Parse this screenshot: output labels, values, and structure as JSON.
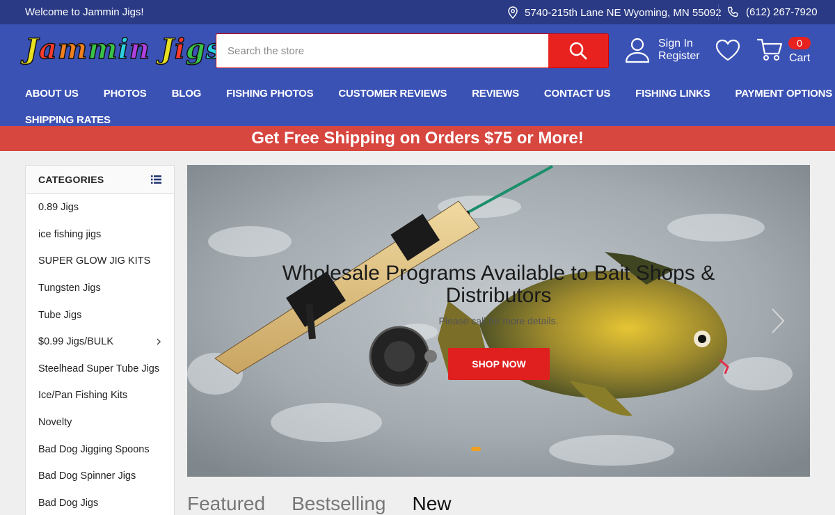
{
  "topbar": {
    "welcome": "Welcome to Jammin Jigs!",
    "address": "5740-215th Lane NE Wyoming, MN 55092",
    "phone": "(612) 267-7920"
  },
  "header": {
    "logo_text": "Jammin Jigs",
    "search_placeholder": "Search the store",
    "sign_in": "Sign In",
    "register": "Register",
    "cart_count": "0",
    "cart_label": "Cart"
  },
  "nav": {
    "row1": [
      "About Us",
      "Photos",
      "Blog",
      "Fishing Photos",
      "Customer Reviews",
      "Reviews",
      "Contact Us",
      "Fishing Links",
      "Payment Options"
    ],
    "row2": [
      "Shipping Rates"
    ]
  },
  "promo": "Get Free Shipping on Orders $75 or More!",
  "sidebar": {
    "heading": "CATEGORIES",
    "categories": [
      "0.89 Jigs",
      "ice fishing jigs",
      "SUPER GLOW JIG KITS",
      "Tungsten Jigs",
      "Tube Jigs",
      "$0.99 Jigs/BULK",
      "Steelhead Super Tube Jigs",
      "Ice/Pan Fishing Kits",
      "Novelty",
      "Bad Dog Jigging Spoons",
      "Bad Dog Spinner Jigs",
      "Bad Dog Jigs"
    ]
  },
  "slide": {
    "title": "Wholesale Programs Available to Bait Shops & Distributors",
    "subtitle": "Please call for more details.",
    "button": "Shop Now"
  },
  "product_tabs": [
    "Featured",
    "Bestselling",
    "New"
  ],
  "colors": {
    "topbar": "#2a3a84",
    "header": "#3b52b5",
    "promo": "#d7463f",
    "accent": "#e8221e"
  }
}
